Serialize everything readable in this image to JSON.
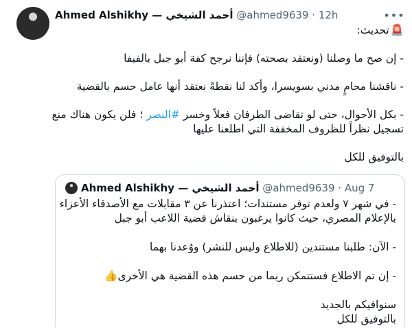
{
  "tweet": {
    "author_name": "Ahmed Alshikhy — أحمد الشيخي",
    "handle": "@ahmed9639",
    "separator": "·",
    "time": "12h",
    "more_icon": "ellipsis-icon",
    "update_label": "تحديث:",
    "update_emoji": "🚨",
    "p1": "- إن صح ما وصلنا (ونعتقد بصحته) فإننا نرجح كفة أبو جبل بالفيفا",
    "p2": "- ناقشنا محامٍ مدني بسويسرا، وأكد لنا نقطةً نعتقد أنها عامل حسم بالقضية",
    "p3a_start": "- بكل الأحوال، حتى لو تقاضى الطرفان فعلاً وخسر ",
    "p3a_hashtag": "#النصر",
    "p3a_end": " ؛ فلن يكون هناك منع",
    "p3b": "تسجيل نظراً للظروف المخففة التي اطلعنا عليها",
    "closing": "بالتوفيق للكل"
  },
  "quote": {
    "author_name": "Ahmed Alshikhy — أحمد الشيخي",
    "handle": "@ahmed9639",
    "separator": "·",
    "date": "Aug 7",
    "l1": "- في شهر ٧ ولعدم توفر مستندات؛ اعتذرنا عن ٣ مقابلات مع الأصدقاء الأعزاء",
    "l2": "بالإعلام المصري، حيث كانوا يرغبون بنقاش قضية اللاعب أبو جبل",
    "l3": "- الآن: طلبنا مستندين (للاطلاع وليس للنشر) ووُعدنا بهما",
    "l4": "- إن تم الاطلاع فستتمكن ربما من حسم هذه القضية هي الأخرى",
    "l4_emoji": "👍",
    "l5": "سنوافيكم بالجديد",
    "l6": "بالتوفيق للكل"
  }
}
